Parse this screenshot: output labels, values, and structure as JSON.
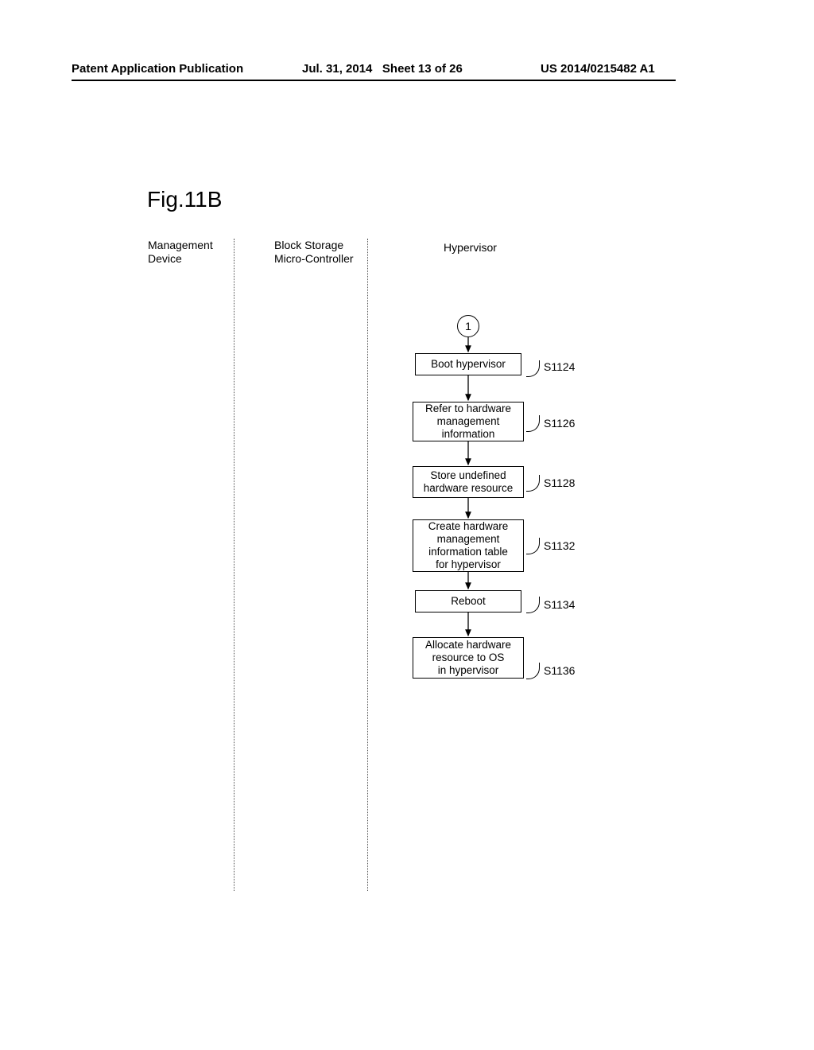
{
  "header": {
    "left": "Patent Application Publication",
    "mid_date": "Jul. 31, 2014",
    "mid_sheet": "Sheet 13 of 26",
    "right": "US 2014/0215482 A1"
  },
  "figure_title": "Fig.11B",
  "lanes": {
    "management": "Management\nDevice",
    "block_storage": "Block Storage\nMicro-Controller",
    "hypervisor": "Hypervisor"
  },
  "connector": "1",
  "steps": [
    {
      "id": "S1124",
      "text": "Boot hypervisor"
    },
    {
      "id": "S1126",
      "text": "Refer to hardware\nmanagement\ninformation"
    },
    {
      "id": "S1128",
      "text": "Store undefined\nhardware resource"
    },
    {
      "id": "S1132",
      "text": "Create hardware\nmanagement\ninformation table\nfor hypervisor"
    },
    {
      "id": "S1134",
      "text": "Reboot"
    },
    {
      "id": "S1136",
      "text": "Allocate hardware\nresource to OS\nin hypervisor"
    }
  ],
  "chart_data": {
    "type": "flowchart",
    "title": "Fig.11B",
    "swimlanes": [
      "Management Device",
      "Block Storage Micro-Controller",
      "Hypervisor"
    ],
    "nodes": [
      {
        "id": "conn1",
        "lane": "Hypervisor",
        "shape": "connector",
        "label": "1"
      },
      {
        "id": "S1124",
        "lane": "Hypervisor",
        "shape": "process",
        "label": "Boot hypervisor"
      },
      {
        "id": "S1126",
        "lane": "Hypervisor",
        "shape": "process",
        "label": "Refer to hardware management information"
      },
      {
        "id": "S1128",
        "lane": "Hypervisor",
        "shape": "process",
        "label": "Store undefined hardware resource"
      },
      {
        "id": "S1132",
        "lane": "Hypervisor",
        "shape": "process",
        "label": "Create hardware management information table for hypervisor"
      },
      {
        "id": "S1134",
        "lane": "Hypervisor",
        "shape": "process",
        "label": "Reboot"
      },
      {
        "id": "S1136",
        "lane": "Hypervisor",
        "shape": "process",
        "label": "Allocate hardware resource to OS in hypervisor"
      }
    ],
    "edges": [
      {
        "from": "conn1",
        "to": "S1124"
      },
      {
        "from": "S1124",
        "to": "S1126"
      },
      {
        "from": "S1126",
        "to": "S1128"
      },
      {
        "from": "S1128",
        "to": "S1132"
      },
      {
        "from": "S1132",
        "to": "S1134"
      },
      {
        "from": "S1134",
        "to": "S1136"
      }
    ]
  }
}
